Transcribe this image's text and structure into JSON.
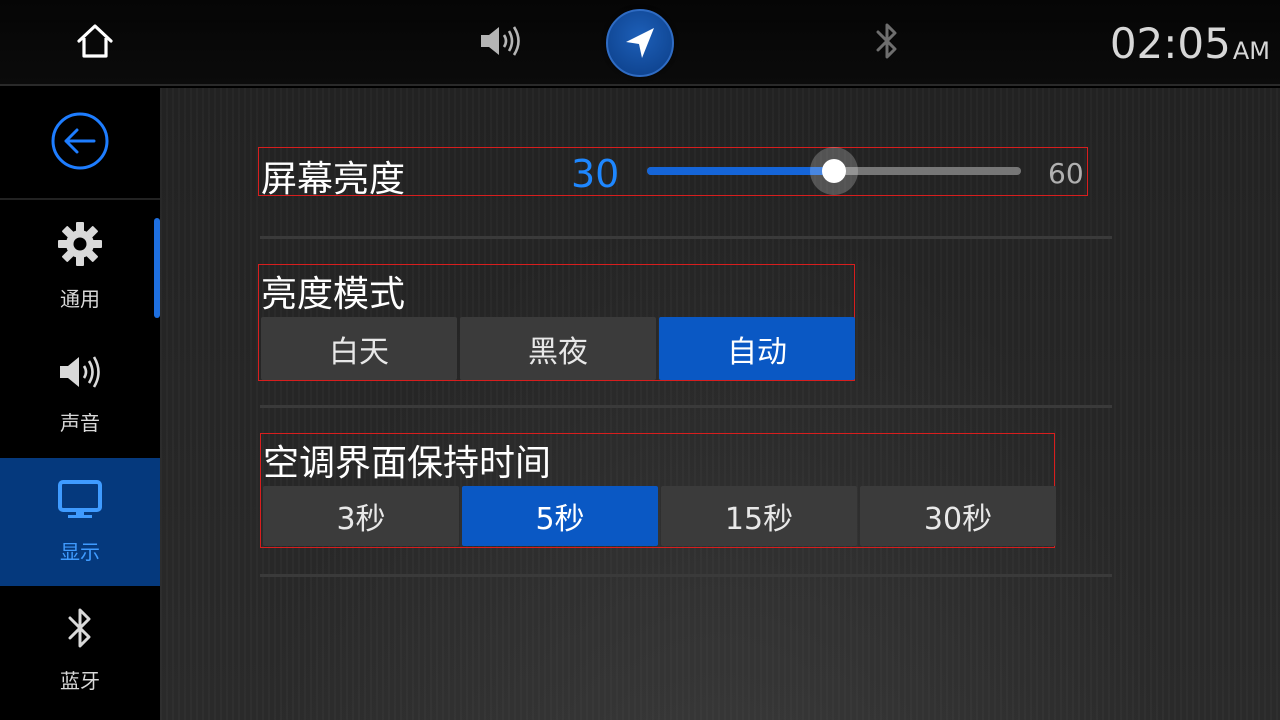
{
  "topbar": {
    "icons": {
      "home": "home-icon",
      "volume": "volume-icon",
      "navigation": "navigation-arrow-icon",
      "bluetooth": "bluetooth-icon"
    },
    "clock": {
      "time": "02:05",
      "ampm": "AM"
    }
  },
  "sidebar": {
    "back_icon": "back-arrow-icon",
    "items": [
      {
        "label": "通用",
        "icon": "gear-icon",
        "active": false
      },
      {
        "label": "声音",
        "icon": "speaker-icon",
        "active": false
      },
      {
        "label": "显示",
        "icon": "monitor-icon",
        "active": true
      },
      {
        "label": "蓝牙",
        "icon": "bluetooth-icon",
        "active": false
      }
    ]
  },
  "brightness": {
    "label": "屏幕亮度",
    "value": "30",
    "max": "60",
    "fraction": 0.5
  },
  "mode": {
    "title": "亮度模式",
    "options": [
      "白天",
      "黑夜",
      "自动"
    ],
    "selected": "自动"
  },
  "timeout": {
    "title": "空调界面保持时间",
    "options": [
      "3秒",
      "5秒",
      "15秒",
      "30秒"
    ],
    "selected": "5秒"
  },
  "colors": {
    "accent": "#0a58c4",
    "accent_text": "#1e87ff",
    "sidebar_active_bg": "#05397d",
    "highlight_border": "#d81e1e"
  }
}
